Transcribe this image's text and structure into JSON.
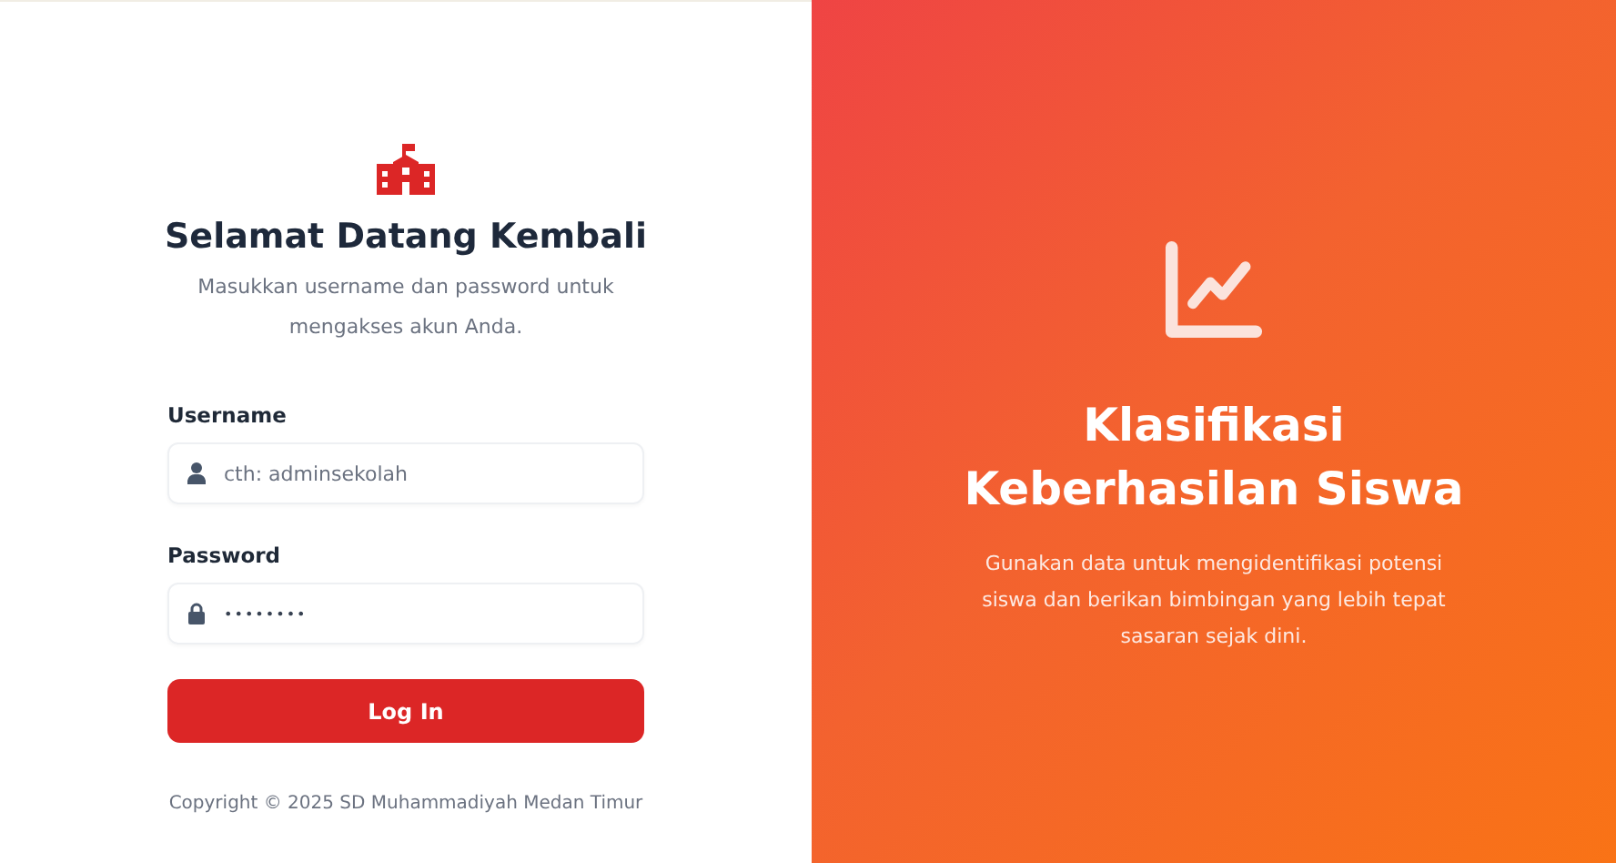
{
  "login": {
    "title": "Selamat Datang Kembali",
    "subtitle": "Masukkan username dan password untuk mengakses akun Anda.",
    "fields": [
      {
        "label": "Username",
        "kind": "text",
        "placeholder": "cth: adminsekolah"
      },
      {
        "label": "Password",
        "kind": "password",
        "value": "••••••••"
      }
    ],
    "button": "Log In",
    "copyright": "Copyright © 2025 SD Muhammadiyah Medan Timur"
  },
  "hero": {
    "title_lines": [
      "Klasifikasi",
      "Keberhasilan Siswa"
    ],
    "description": "Gunakan data untuk mengidentifikasi potensi siswa dan berikan bimbingan yang lebih tepat sasaran sejak dini."
  }
}
